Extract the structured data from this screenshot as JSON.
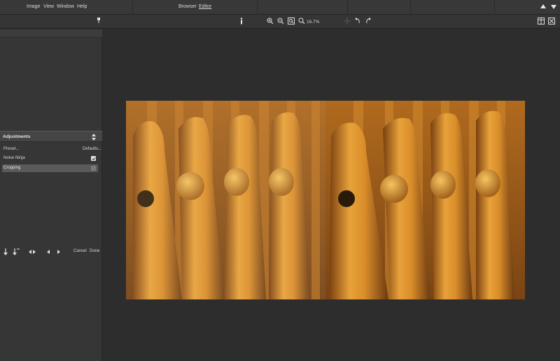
{
  "menubar": {
    "items": [
      "Image",
      "View",
      "Window",
      "Help"
    ],
    "modes": [
      "Browser",
      "Editor"
    ],
    "active_mode": "Editor"
  },
  "toolbar": {
    "zoom_level": "16.7%",
    "icons": [
      "info-icon",
      "zoom-in-icon",
      "zoom-out-icon",
      "zoom-fit-icon",
      "zoom-icon",
      "crosshair-icon",
      "rotate-left-icon",
      "rotate-right-icon",
      "split-view-icon",
      "compare-view-icon"
    ]
  },
  "sidebar": {
    "adjustments": {
      "title": "Adjustments",
      "preset_label": "Preset...",
      "defaults_label": "Defaults..."
    },
    "items": [
      {
        "label": "Noise Ninja",
        "checked": true
      },
      {
        "label": "Cropping",
        "checked": false,
        "selected": true
      }
    ],
    "bottom": {
      "cancel_label": "Cancel",
      "done_label": "Done"
    }
  },
  "canvas": {
    "background": "#2d2d2d",
    "image_description": "before-after"
  },
  "colors": {
    "menubar": "#383838",
    "panel": "#363636",
    "header": "#454545",
    "selected_row": "#5a5a5a",
    "wood_light": "#e8a23a",
    "wood_dark": "#6b3a12"
  }
}
